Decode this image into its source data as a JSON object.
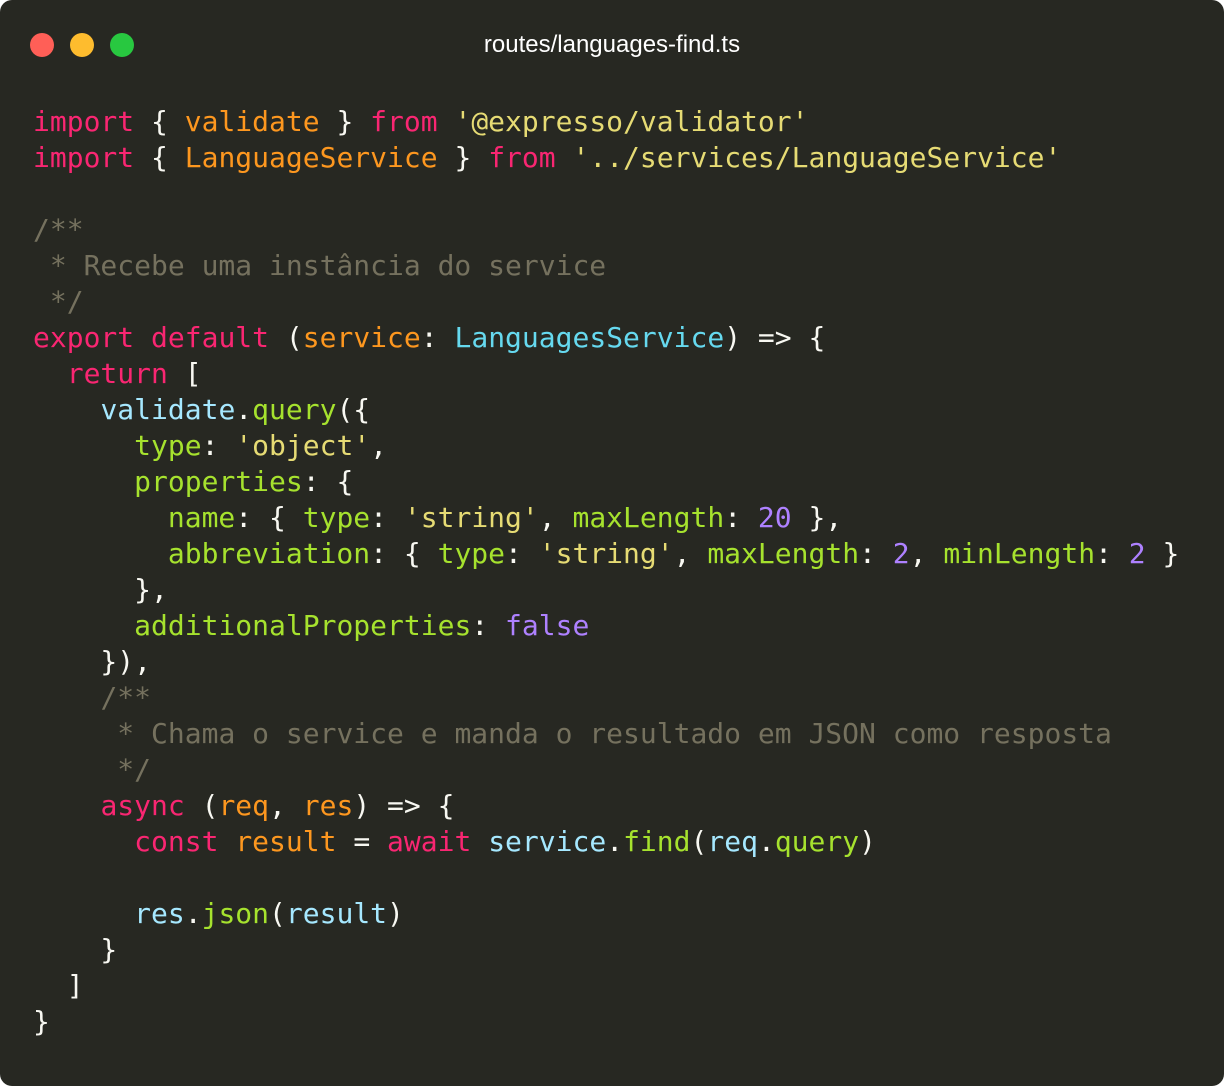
{
  "window": {
    "title": "routes/languages-find.ts",
    "controls": [
      "close",
      "minimize",
      "maximize"
    ],
    "colors": {
      "background": "#272822",
      "close": "#ff5f57",
      "minimize": "#febc2e",
      "maximize": "#28c840"
    }
  },
  "code": {
    "language": "typescript",
    "lines": [
      [
        [
          "keyword",
          "import"
        ],
        [
          "plain",
          " { "
        ],
        [
          "ident",
          "validate"
        ],
        [
          "plain",
          " } "
        ],
        [
          "keyword",
          "from"
        ],
        [
          "plain",
          " "
        ],
        [
          "string",
          "'@expresso/validator'"
        ]
      ],
      [
        [
          "keyword",
          "import"
        ],
        [
          "plain",
          " { "
        ],
        [
          "ident",
          "LanguageService"
        ],
        [
          "plain",
          " } "
        ],
        [
          "keyword",
          "from"
        ],
        [
          "plain",
          " "
        ],
        [
          "string",
          "'../services/LanguageService'"
        ]
      ],
      [],
      [
        [
          "comment",
          "/**"
        ]
      ],
      [
        [
          "comment",
          " * Recebe uma instância do service"
        ]
      ],
      [
        [
          "comment",
          " */"
        ]
      ],
      [
        [
          "keyword",
          "export"
        ],
        [
          "plain",
          " "
        ],
        [
          "keyword",
          "default"
        ],
        [
          "plain",
          " ("
        ],
        [
          "ident",
          "service"
        ],
        [
          "plain",
          ": "
        ],
        [
          "type",
          "LanguagesService"
        ],
        [
          "plain",
          ") => {"
        ]
      ],
      [
        [
          "plain",
          "  "
        ],
        [
          "keyword",
          "return"
        ],
        [
          "plain",
          " ["
        ]
      ],
      [
        [
          "plain",
          "    "
        ],
        [
          "var",
          "validate"
        ],
        [
          "plain",
          "."
        ],
        [
          "func",
          "query"
        ],
        [
          "plain",
          "({"
        ]
      ],
      [
        [
          "plain",
          "      "
        ],
        [
          "prop",
          "type"
        ],
        [
          "plain",
          ": "
        ],
        [
          "string",
          "'object'"
        ],
        [
          "plain",
          ","
        ]
      ],
      [
        [
          "plain",
          "      "
        ],
        [
          "prop",
          "properties"
        ],
        [
          "plain",
          ": {"
        ]
      ],
      [
        [
          "plain",
          "        "
        ],
        [
          "prop",
          "name"
        ],
        [
          "plain",
          ": { "
        ],
        [
          "prop",
          "type"
        ],
        [
          "plain",
          ": "
        ],
        [
          "string",
          "'string'"
        ],
        [
          "plain",
          ", "
        ],
        [
          "prop",
          "maxLength"
        ],
        [
          "plain",
          ": "
        ],
        [
          "number",
          "20"
        ],
        [
          "plain",
          " },"
        ]
      ],
      [
        [
          "plain",
          "        "
        ],
        [
          "prop",
          "abbreviation"
        ],
        [
          "plain",
          ": { "
        ],
        [
          "prop",
          "type"
        ],
        [
          "plain",
          ": "
        ],
        [
          "string",
          "'string'"
        ],
        [
          "plain",
          ", "
        ],
        [
          "prop",
          "maxLength"
        ],
        [
          "plain",
          ": "
        ],
        [
          "number",
          "2"
        ],
        [
          "plain",
          ", "
        ],
        [
          "prop",
          "minLength"
        ],
        [
          "plain",
          ": "
        ],
        [
          "number",
          "2"
        ],
        [
          "plain",
          " }"
        ]
      ],
      [
        [
          "plain",
          "      },"
        ]
      ],
      [
        [
          "plain",
          "      "
        ],
        [
          "prop",
          "additionalProperties"
        ],
        [
          "plain",
          ": "
        ],
        [
          "bool",
          "false"
        ]
      ],
      [
        [
          "plain",
          "    }),"
        ]
      ],
      [
        [
          "plain",
          "    "
        ],
        [
          "comment",
          "/**"
        ]
      ],
      [
        [
          "plain",
          "     "
        ],
        [
          "comment",
          "* Chama o service e manda o resultado em JSON como resposta"
        ]
      ],
      [
        [
          "plain",
          "     "
        ],
        [
          "comment",
          "*/"
        ]
      ],
      [
        [
          "plain",
          "    "
        ],
        [
          "keyword",
          "async"
        ],
        [
          "plain",
          " ("
        ],
        [
          "ident",
          "req"
        ],
        [
          "plain",
          ", "
        ],
        [
          "ident",
          "res"
        ],
        [
          "plain",
          ") => {"
        ]
      ],
      [
        [
          "plain",
          "      "
        ],
        [
          "keyword",
          "const"
        ],
        [
          "plain",
          " "
        ],
        [
          "ident",
          "result"
        ],
        [
          "plain",
          " = "
        ],
        [
          "keyword",
          "await"
        ],
        [
          "plain",
          " "
        ],
        [
          "var",
          "service"
        ],
        [
          "plain",
          "."
        ],
        [
          "func",
          "find"
        ],
        [
          "plain",
          "("
        ],
        [
          "var",
          "req"
        ],
        [
          "plain",
          "."
        ],
        [
          "func",
          "query"
        ],
        [
          "plain",
          ")"
        ]
      ],
      [],
      [
        [
          "plain",
          "      "
        ],
        [
          "var",
          "res"
        ],
        [
          "plain",
          "."
        ],
        [
          "func",
          "json"
        ],
        [
          "plain",
          "("
        ],
        [
          "var",
          "result"
        ],
        [
          "plain",
          ")"
        ]
      ],
      [
        [
          "plain",
          "    }"
        ]
      ],
      [
        [
          "plain",
          "  ]"
        ]
      ],
      [
        [
          "plain",
          "}"
        ]
      ]
    ]
  }
}
